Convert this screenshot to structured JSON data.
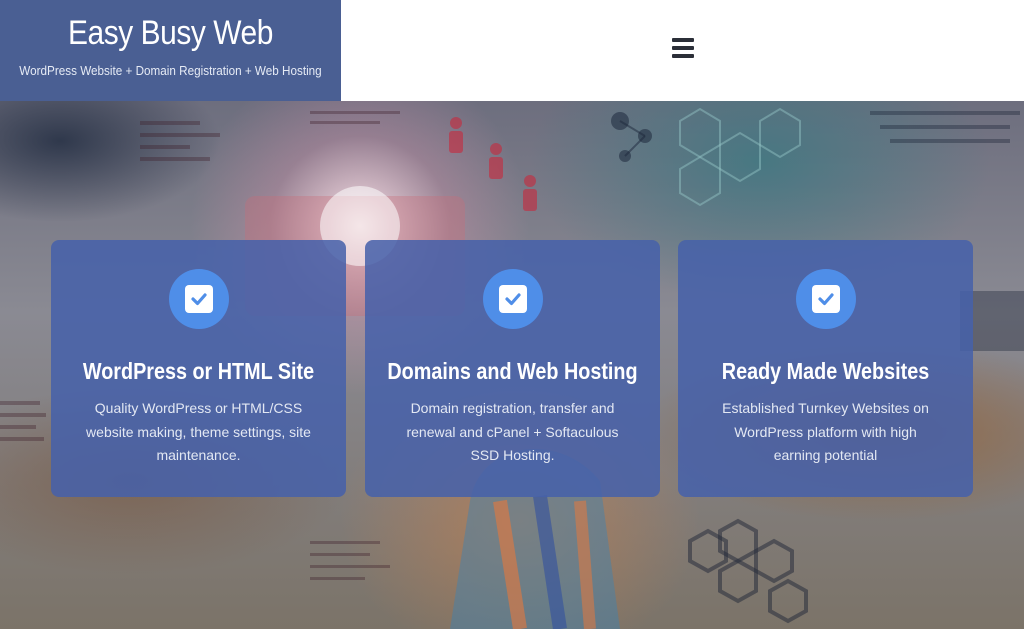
{
  "header": {
    "site_title": "Easy Busy Web",
    "tagline": "WordPress Website + Domain Registration + Web Hosting"
  },
  "colors": {
    "brand": "#4a5f93",
    "card": "#4661aa",
    "icon_circle": "#4f8ee8"
  },
  "features": [
    {
      "icon": "checkbox-checked-icon",
      "title": "WordPress or HTML Site",
      "text": "Quality WordPress or HTML/CSS website making, theme settings, site maintenance."
    },
    {
      "icon": "checkbox-checked-icon",
      "title": "Domains and Web Hosting",
      "text": "Domain registration, transfer and renewal and cPanel + Softaculous SSD Hosting."
    },
    {
      "icon": "checkbox-checked-icon",
      "title": "Ready Made Websites",
      "text": "Established Turnkey Websites on WordPress platform with high earning potential"
    }
  ]
}
